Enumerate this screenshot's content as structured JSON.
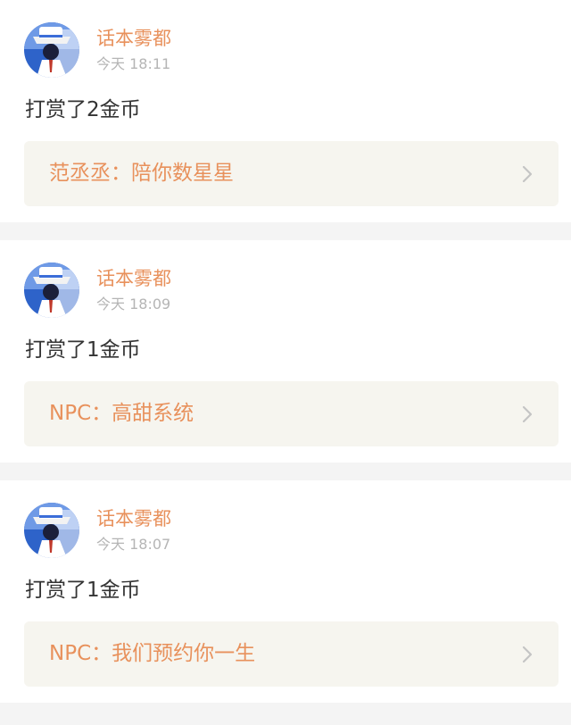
{
  "feed": [
    {
      "user": "话本雾都",
      "time": "今天 18:11",
      "message": "打赏了2金币",
      "book": "范丞丞：陪你数星星",
      "icons": {
        "avatar": "avatar-image",
        "chevron": "chevron-right-icon"
      }
    },
    {
      "user": "话本雾都",
      "time": "今天 18:09",
      "message": "打赏了1金币",
      "book": "NPC：高甜系统",
      "icons": {
        "avatar": "avatar-image",
        "chevron": "chevron-right-icon"
      }
    },
    {
      "user": "话本雾都",
      "time": "今天 18:07",
      "message": "打赏了1金币",
      "book": "NPC：我们预约你一生",
      "icons": {
        "avatar": "avatar-image",
        "chevron": "chevron-right-icon"
      }
    }
  ],
  "colors": {
    "accent": "#e8915c",
    "muted": "#b5b5b5",
    "text": "#333333",
    "link_bg": "#f6f5ef",
    "separator": "#f4f4f4"
  }
}
